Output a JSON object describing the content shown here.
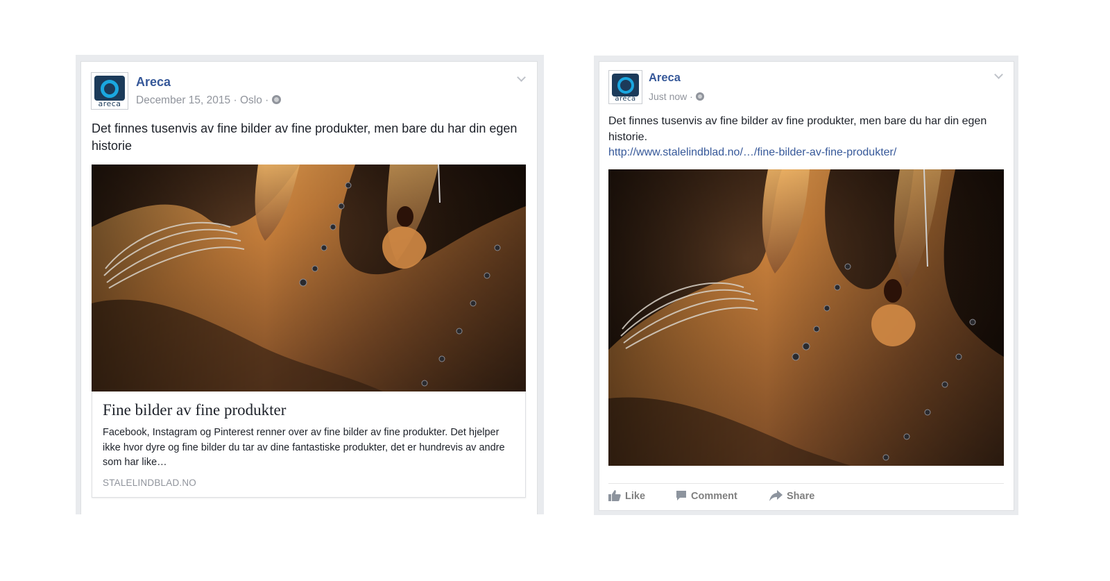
{
  "left_post": {
    "author": "Areca",
    "avatar_text": "areca",
    "date": "December 15, 2015",
    "sep1": "·",
    "location": "Oslo",
    "sep2": "·",
    "message": "Det finnes tusenvis av fine bilder av fine produkter, men bare du har din egen historie",
    "link_preview": {
      "title": "Fine bilder av fine produkter",
      "description": "Facebook, Instagram og Pinterest renner over av fine bilder av fine produkter. Det hjelper ikke hvor dyre og fine bilder du tar av dine fantastiske produkter, det er hundrevis av andre som har like…",
      "domain": "STALELINDBLAD.NO"
    }
  },
  "right_post": {
    "author": "Areca",
    "avatar_text": "areca",
    "timestamp": "Just now",
    "sep1": "·",
    "message": "Det finnes tusenvis av fine bilder av fine produkter, men bare du har din egen historie.",
    "link": "http://www.stalelindblad.no/…/fine-bilder-av-fine-produkter/",
    "actions": {
      "like": "Like",
      "comment": "Comment",
      "share": "Share"
    }
  },
  "icons": {
    "privacy": "globe-icon",
    "menu": "chevron-down-icon",
    "like": "thumbs-up-icon",
    "comment": "speech-bubble-icon",
    "share": "share-arrow-icon"
  },
  "colors": {
    "author_link": "#365899",
    "meta_gray": "#90949c",
    "frame_gray": "#e9ebee",
    "logo_blue": "#1aa7e0",
    "logo_navy": "#1c3b5a"
  }
}
